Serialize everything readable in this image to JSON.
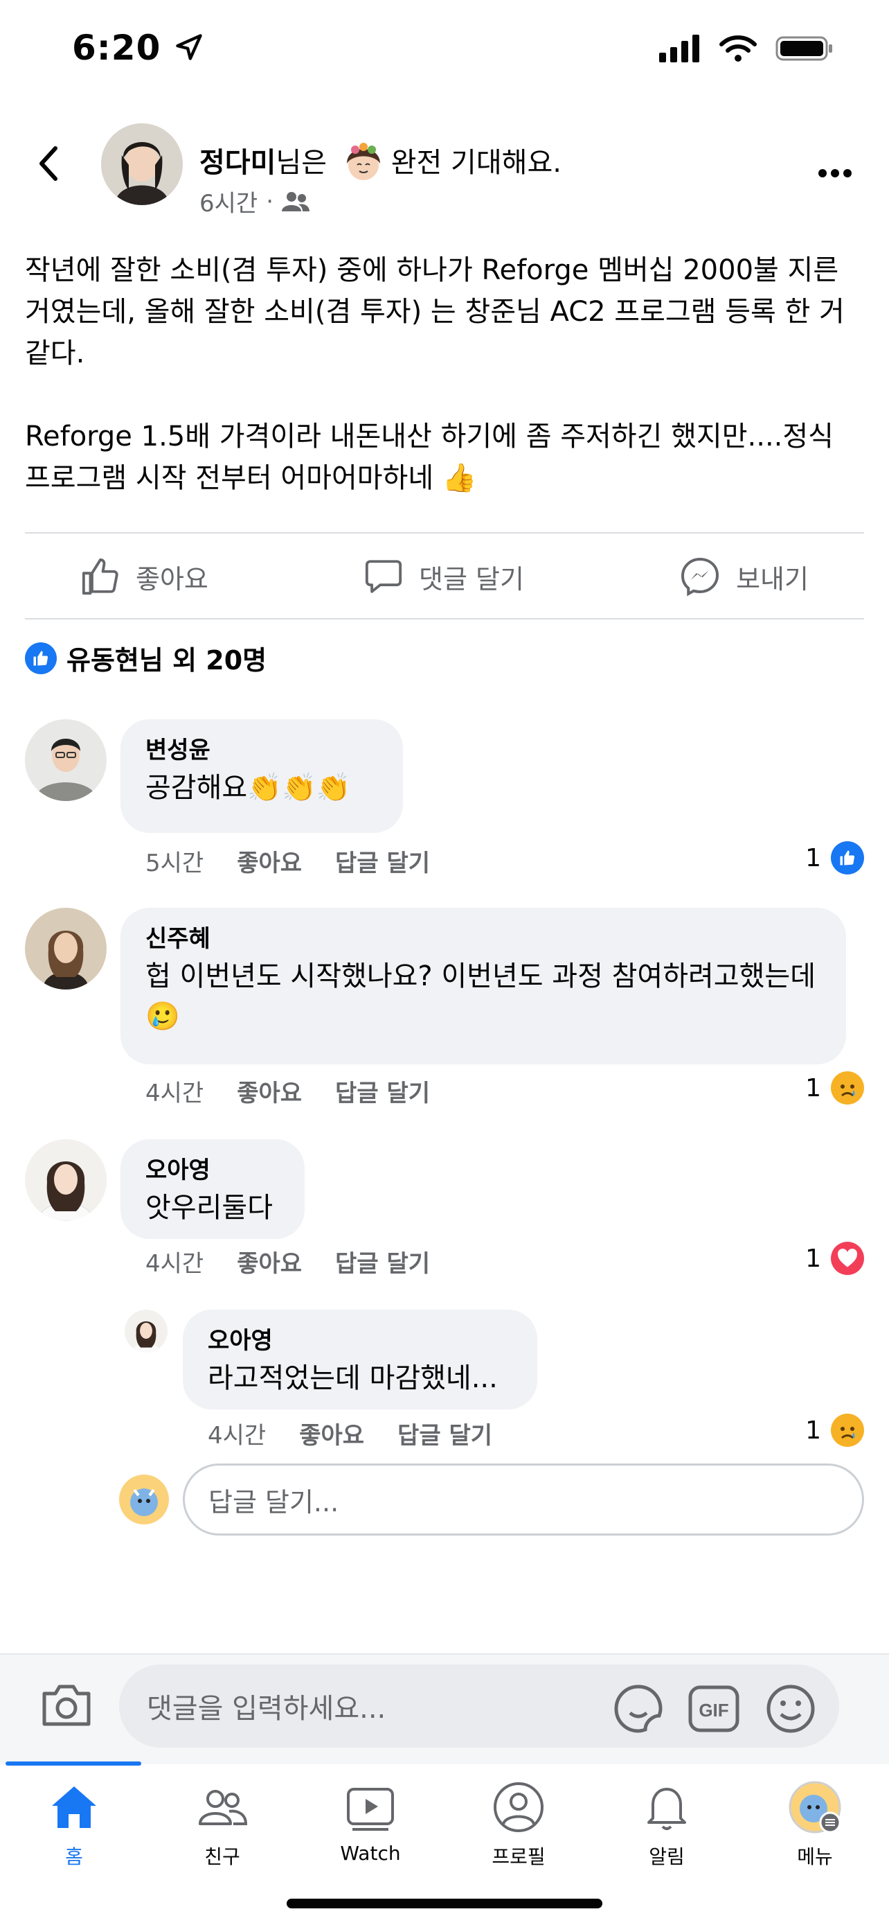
{
  "status_bar": {
    "time": "6:20"
  },
  "post": {
    "author": "정다미",
    "status_suffix": "님은",
    "feeling": "완전 기대해요.",
    "timestamp": "6시간",
    "audience_separator": "·",
    "body": "작년에 잘한 소비(겸 투자) 중에 하나가 Reforge 멤버십 2000불 지른거였는데, 올해 잘한 소비(겸 투자) 는 창준님 AC2 프로그램 등록 한 거 같다.\n\nReforge 1.5배 가격이라 내돈내산 하기에 좀 주저하긴 했지만....정식 프로그램 시작 전부터 어마어마하네 👍"
  },
  "actions": {
    "like": "좋아요",
    "comment": "댓글 달기",
    "send": "보내기"
  },
  "reactions_summary": "유동현님 외 20명",
  "comments": [
    {
      "name": "변성윤",
      "text": "공감해요👏👏👏",
      "time": "5시간",
      "like": "좋아요",
      "reply": "답글 달기",
      "count": "1",
      "reaction": "like-icon"
    },
    {
      "name": "신주혜",
      "text": "헙 이번년도 시작했나요? 이번년도 과정 참여하려고했는데🥲",
      "time": "4시간",
      "like": "좋아요",
      "reply": "답글 달기",
      "count": "1",
      "reaction": "sad-icon"
    },
    {
      "name": "오아영",
      "text": "앗우리둘다",
      "time": "4시간",
      "like": "좋아요",
      "reply": "답글 달기",
      "count": "1",
      "reaction": "love-icon"
    }
  ],
  "reply": {
    "name": "오아영",
    "text": "라고적었는데 마감했네...",
    "time": "4시간",
    "like": "좋아요",
    "reply": "답글 달기",
    "count": "1",
    "reaction": "sad-icon"
  },
  "reply_input_placeholder": "답글 달기...",
  "composer_placeholder": "댓글을 입력하세요...",
  "tabs": [
    {
      "label": "홈",
      "icon": "home-icon"
    },
    {
      "label": "친구",
      "icon": "friends-icon"
    },
    {
      "label": "Watch",
      "icon": "watch-icon"
    },
    {
      "label": "프로필",
      "icon": "profile-icon"
    },
    {
      "label": "알림",
      "icon": "bell-icon"
    },
    {
      "label": "메뉴",
      "icon": "menu-avatar-icon"
    }
  ],
  "colors": {
    "accent": "#1877f2",
    "bubble": "#f0f2f5",
    "muted": "#65676b",
    "love": "#f33e58",
    "sad": "#f7b125"
  }
}
